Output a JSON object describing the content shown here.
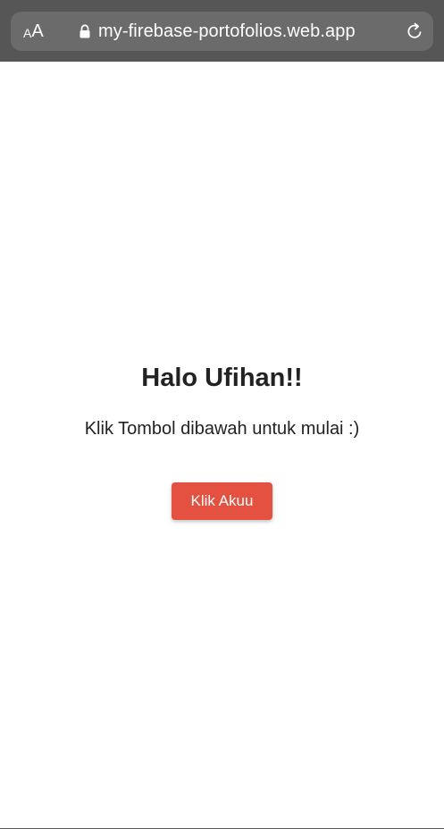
{
  "browser": {
    "text_size_small": "A",
    "text_size_large": "A",
    "url": "my-firebase-portofolios.web.app",
    "lock_icon": "lock-icon",
    "reload_icon": "reload-icon"
  },
  "page": {
    "title": "Halo Ufihan!!",
    "subtitle": "Klik Tombol dibawah untuk mulai :)",
    "button_label": "Klik Akuu"
  },
  "colors": {
    "toolbar": "#565656",
    "address_bar": "#6b6b6b",
    "button": "#e55141",
    "text": "#222222"
  }
}
